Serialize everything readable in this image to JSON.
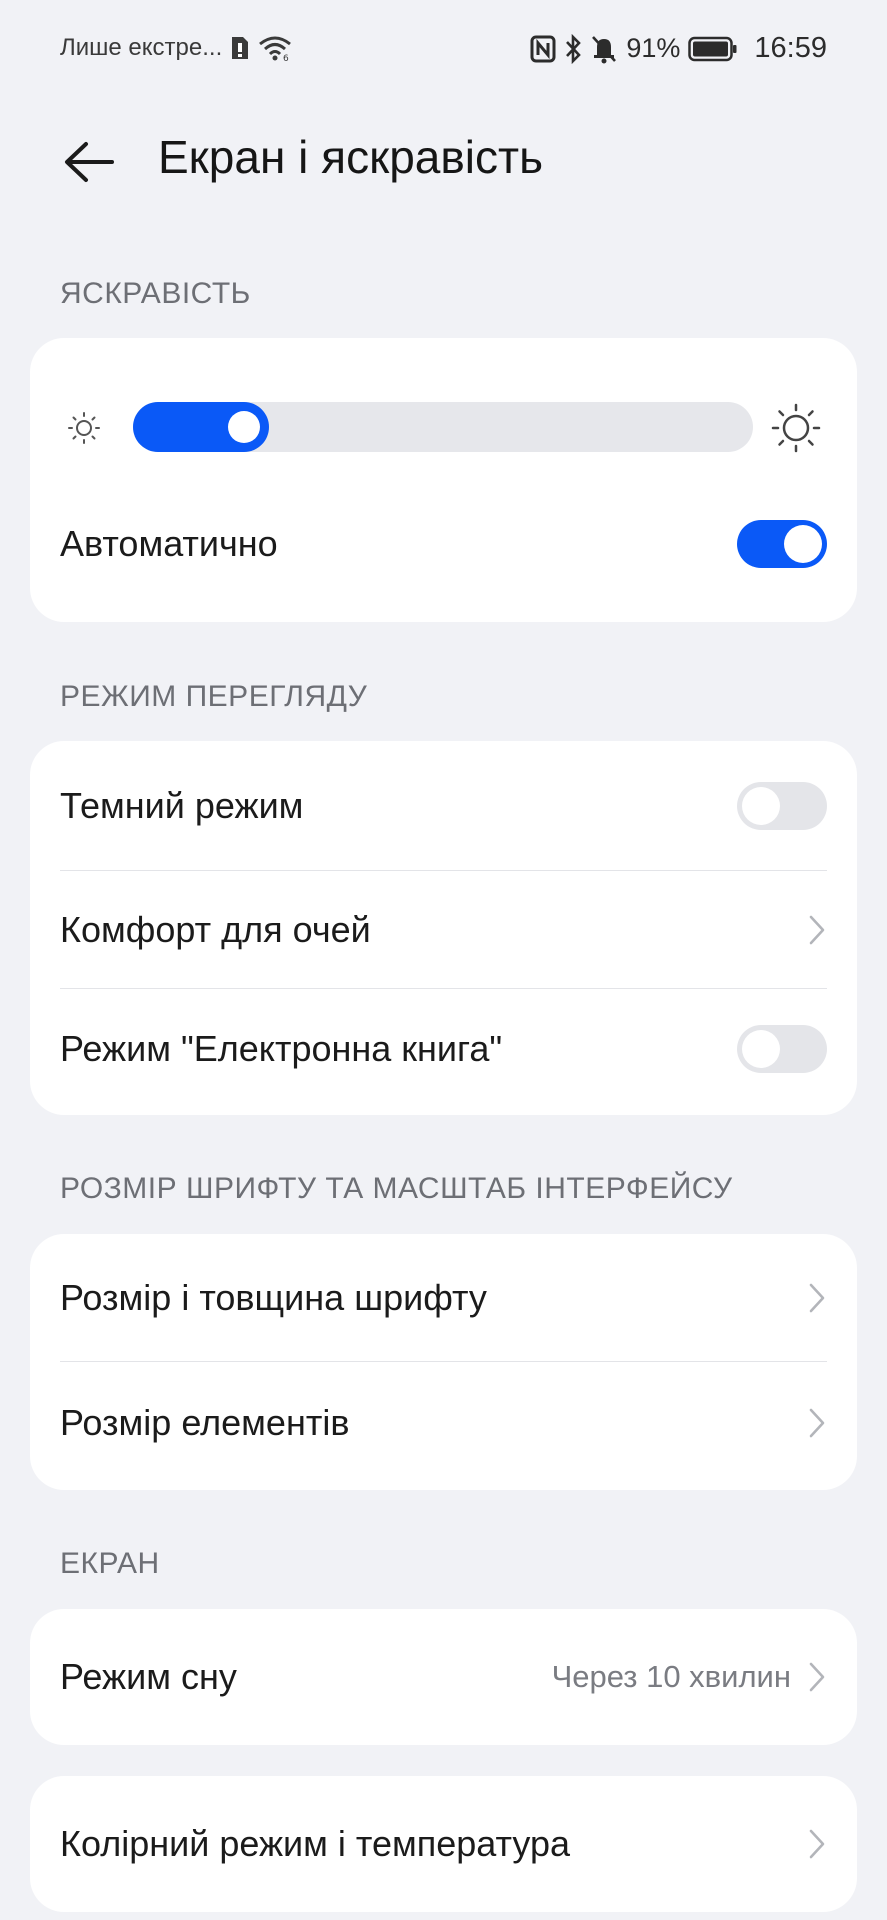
{
  "status_bar": {
    "carrier": "Лише екстре...",
    "battery_percent": "91%",
    "time": "16:59",
    "icons": [
      "sim-icon",
      "wifi-icon",
      "nfc-icon",
      "bluetooth-icon",
      "silent-icon",
      "battery-icon"
    ]
  },
  "header": {
    "title": "Екран і яскравість",
    "back_icon": "arrow-left-icon"
  },
  "brightness": {
    "section_label": "ЯСКРАВІСТЬ",
    "level": 0.22,
    "auto_label": "Автоматично",
    "auto_on": true
  },
  "view_mode": {
    "section_label": "РЕЖИМ ПЕРЕГЛЯДУ",
    "dark_mode_label": "Темний режим",
    "dark_mode_on": false,
    "eye_comfort_label": "Комфорт для очей",
    "ebook_label": "Режим \"Електронна книга\"",
    "ebook_on": false
  },
  "font_scale": {
    "section_label": "РОЗМІР ШРИФТУ ТА МАСШТАБ ІНТЕРФЕЙСУ",
    "font_size_label": "Розмір і товщина шрифту",
    "display_size_label": "Розмір елементів"
  },
  "screen": {
    "section_label": "ЕКРАН",
    "sleep_label": "Режим сну",
    "sleep_value": "Через 10 хвилин",
    "color_mode_label": "Колірний режим і температура"
  },
  "colors": {
    "accent": "#0a59f7",
    "background": "#f1f2f6",
    "card": "#ffffff"
  }
}
